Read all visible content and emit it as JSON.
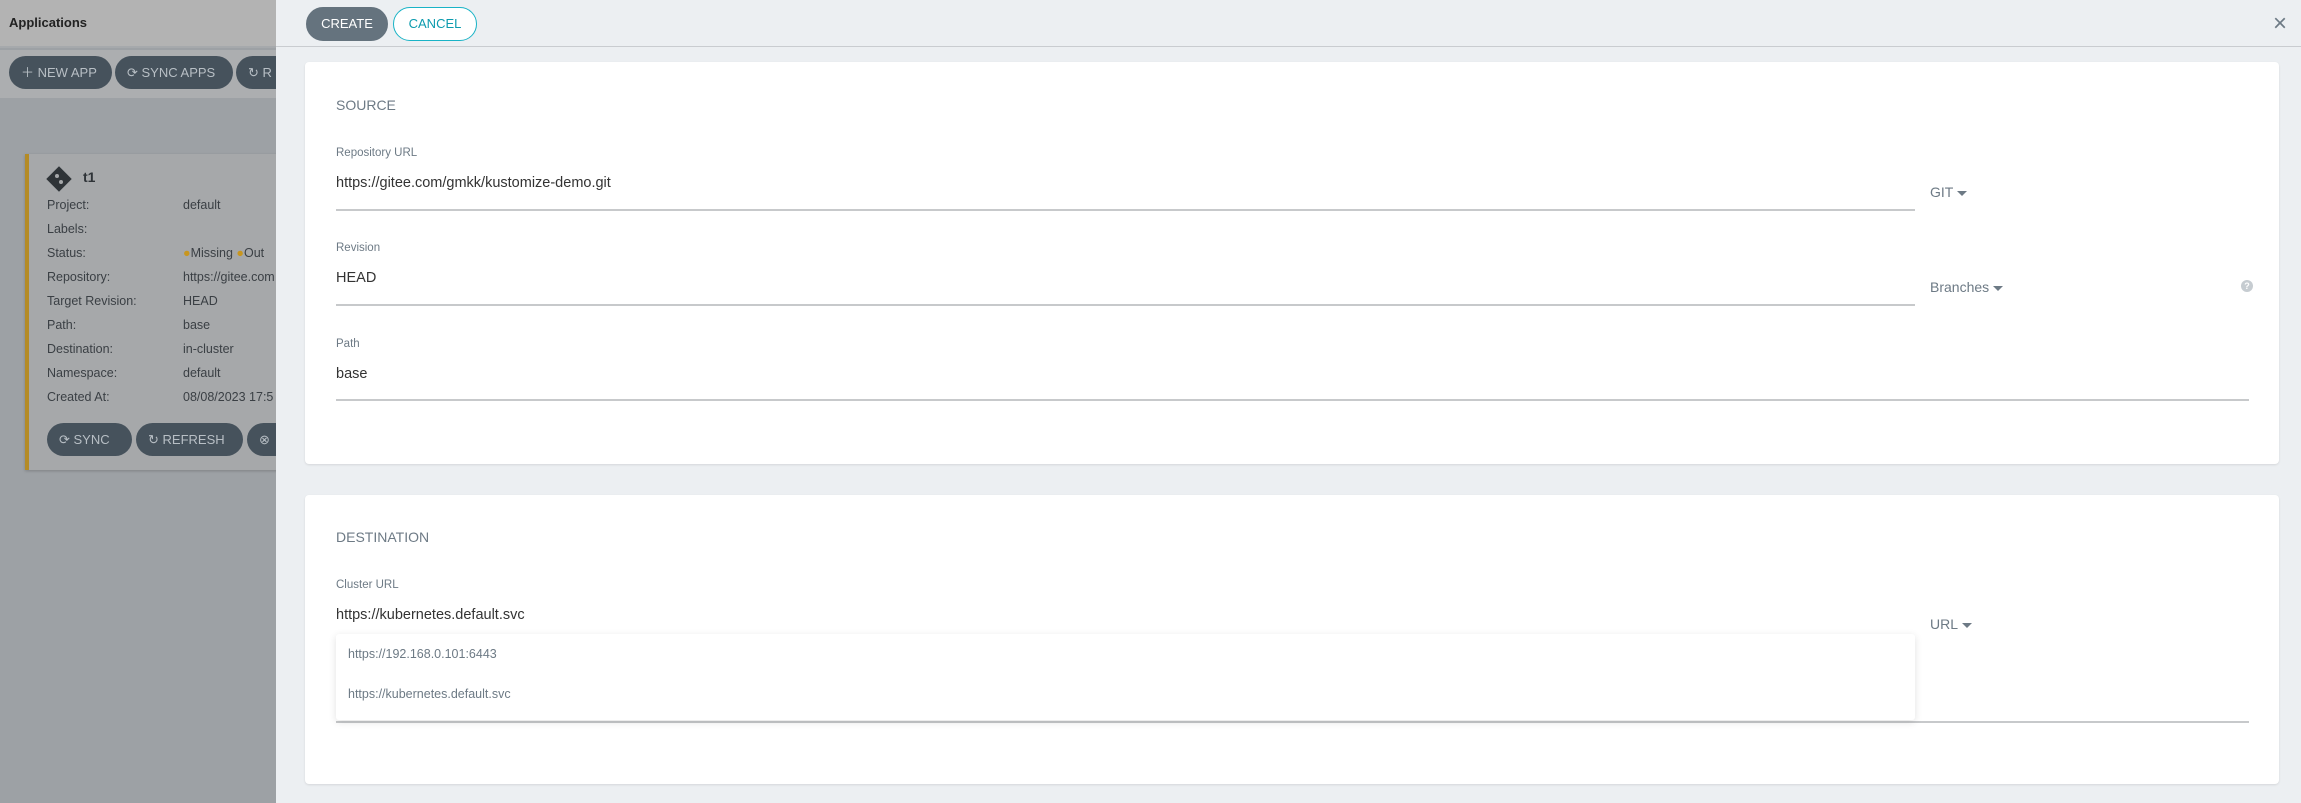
{
  "background": {
    "title": "Applications",
    "toolbar": [
      "NEW APP",
      "SYNC APPS",
      "R"
    ],
    "app_card": {
      "name": "t1",
      "rows": [
        {
          "label": "Project:",
          "value": "default"
        },
        {
          "label": "Labels:",
          "value": ""
        },
        {
          "label": "Status:",
          "value": "Missing",
          "value2": "Out"
        },
        {
          "label": "Repository:",
          "value": "https://gitee.com"
        },
        {
          "label": "Target Revision:",
          "value": "HEAD"
        },
        {
          "label": "Path:",
          "value": "base"
        },
        {
          "label": "Destination:",
          "value": "in-cluster"
        },
        {
          "label": "Namespace:",
          "value": "default"
        },
        {
          "label": "Created At:",
          "value": "08/08/2023 17:5"
        }
      ],
      "buttons": [
        "SYNC",
        "REFRESH"
      ]
    }
  },
  "panel": {
    "create": "CREATE",
    "cancel": "CANCEL",
    "close_icon": "×",
    "source": {
      "title": "SOURCE",
      "repo_label": "Repository URL",
      "repo_value": "https://gitee.com/gmkk/kustomize-demo.git",
      "repo_type": "GIT",
      "rev_label": "Revision",
      "rev_value": "HEAD",
      "rev_type": "Branches",
      "path_label": "Path",
      "path_value": "base"
    },
    "destination": {
      "title": "DESTINATION",
      "cluster_label": "Cluster URL",
      "cluster_value": "https://kubernetes.default.svc",
      "cluster_type": "URL",
      "options": [
        "https://192.168.0.101:6443",
        "https://kubernetes.default.svc"
      ]
    }
  }
}
